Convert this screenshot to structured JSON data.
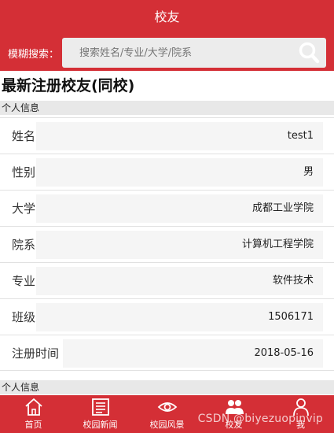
{
  "header": {
    "title": "校友"
  },
  "search": {
    "label": "模糊搜索：",
    "placeholder": "搜索姓名/专业/大学/院系"
  },
  "page_title": "最新注册校友(同校)",
  "section_title": "个人信息",
  "fields": [
    {
      "label": "姓名",
      "value": "test1"
    },
    {
      "label": "性别",
      "value": "男"
    },
    {
      "label": "大学",
      "value": "成都工业学院"
    },
    {
      "label": "院系",
      "value": "计算机工程学院"
    },
    {
      "label": "专业",
      "value": "软件技术"
    },
    {
      "label": "班级",
      "value": "1506171"
    },
    {
      "label": "注册时间",
      "value": "2018-05-16"
    }
  ],
  "section_title_2": "个人信息",
  "tabs": [
    {
      "label": "首页",
      "icon": "home-icon"
    },
    {
      "label": "校园新闻",
      "icon": "news-icon"
    },
    {
      "label": "校园风景",
      "icon": "eye-icon"
    },
    {
      "label": "校友",
      "icon": "alumni-icon"
    },
    {
      "label": "我",
      "icon": "user-icon"
    }
  ],
  "watermark": "CSDN @biyezuopinvip",
  "colors": {
    "brand": "#d42f36",
    "field_bg": "#f5f5f5",
    "section_bg": "#e8e8e8"
  }
}
